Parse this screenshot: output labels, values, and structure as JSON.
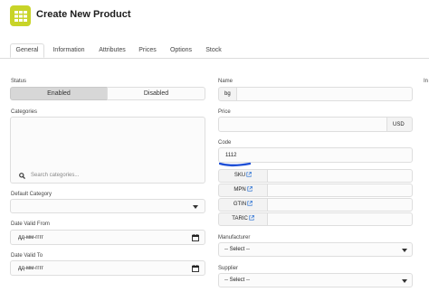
{
  "header": {
    "title": "Create New Product",
    "icon": "grid-icon",
    "accent": "#c8d428"
  },
  "tabs": [
    {
      "label": "General",
      "active": true
    },
    {
      "label": "Information"
    },
    {
      "label": "Attributes"
    },
    {
      "label": "Prices"
    },
    {
      "label": "Options"
    },
    {
      "label": "Stock"
    }
  ],
  "form": {
    "status": {
      "label": "Status",
      "options": [
        "Enabled",
        "Disabled"
      ],
      "selected": "Enabled"
    },
    "categories": {
      "label": "Categories",
      "search_placeholder": "Search categories..."
    },
    "default_category": {
      "label": "Default Category",
      "value": ""
    },
    "date_valid_from": {
      "label": "Date Valid From",
      "value": "дд-мм-гггг"
    },
    "date_valid_to": {
      "label": "Date Valid To",
      "value": "дд-мм-гггг"
    },
    "name": {
      "label": "Name",
      "lang": "bg",
      "value": ""
    },
    "price": {
      "label": "Price",
      "currency": "USD",
      "value": ""
    },
    "code": {
      "label": "Code",
      "value": "1112",
      "underline_color": "#1e4fd6"
    },
    "codes": [
      {
        "label": "SKU",
        "value": ""
      },
      {
        "label": "MPN",
        "value": ""
      },
      {
        "label": "GTIN",
        "value": ""
      },
      {
        "label": "TARIC",
        "value": ""
      }
    ],
    "manufacturer": {
      "label": "Manufacturer",
      "value": "-- Select --"
    },
    "supplier": {
      "label": "Supplier",
      "value": "-- Select --"
    },
    "clipped_label": "In"
  },
  "colors": {
    "link_icon": "#3a7bd5",
    "segment_active_bg": "#d7d7d7"
  }
}
